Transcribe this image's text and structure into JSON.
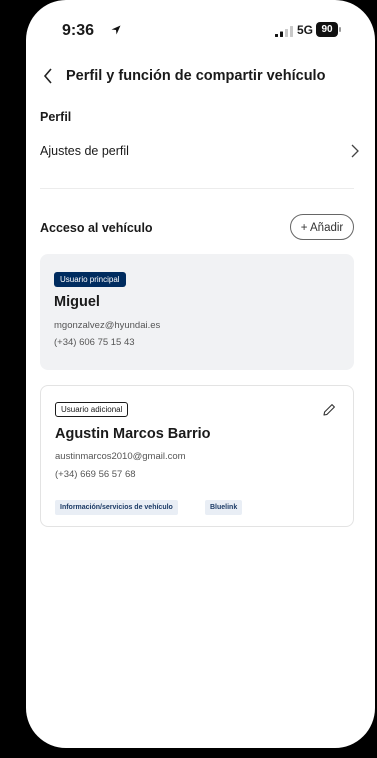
{
  "status_bar": {
    "time": "9:36",
    "network": "5G",
    "battery": "90"
  },
  "header": {
    "title": "Perfil y función de compartir vehículo"
  },
  "profile": {
    "section_title": "Perfil",
    "settings_label": "Ajustes de perfil"
  },
  "access": {
    "section_title": "Acceso al vehículo",
    "add_label": "+ Añadir",
    "users": [
      {
        "role": "Usuario principal",
        "name": "Miguel",
        "email": "mgonzalvez@hyundai.es",
        "phone": "(+34) 606 75 15 43"
      },
      {
        "role": "Usuario adicional",
        "name": "Agustin Marcos Barrio",
        "email": "austinmarcos2010@gmail.com",
        "phone": "(+34) 669 56 57 68",
        "tags": [
          "Información/servicios de vehículo",
          "Bluelink"
        ]
      }
    ]
  },
  "icons": {
    "back": "chevron-left-icon",
    "chevron": "chevron-right-icon",
    "edit": "pencil-icon",
    "location": "location-arrow-icon"
  },
  "colors": {
    "primary_badge": "#002c5f",
    "card_bg": "#f1f2f4",
    "tag_bg": "#e9eef5"
  }
}
